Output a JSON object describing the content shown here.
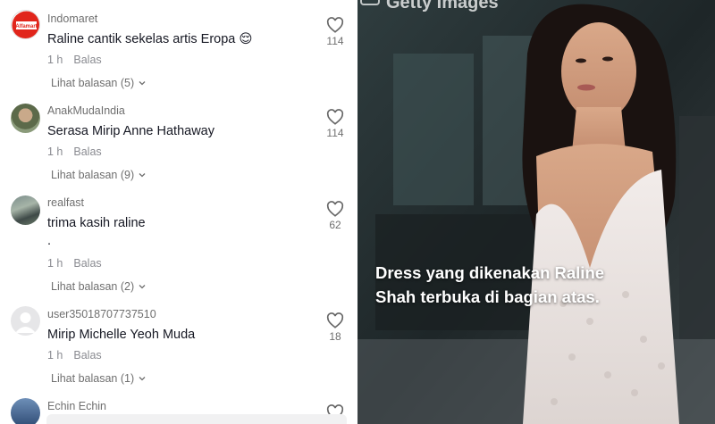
{
  "comments": [
    {
      "username": "Indomaret",
      "text": "Raline cantik sekelas artis Eropa 😌",
      "time": "1 h",
      "reply": "Balas",
      "replies": "Lihat balasan (5)",
      "likes": "114",
      "avatar": "indomaret-logo"
    },
    {
      "username": "AnakMudaIndia",
      "text": "Serasa Mirip Anne Hathaway",
      "time": "1 h",
      "reply": "Balas",
      "replies": "Lihat balasan (9)",
      "likes": "114",
      "avatar": "photo"
    },
    {
      "username": "realfast",
      "text": "trima kasih raline",
      "text2": ".",
      "time": "1 h",
      "reply": "Balas",
      "replies": "Lihat balasan (2)",
      "likes": "62",
      "avatar": "photo"
    },
    {
      "username": "user35018707737510",
      "text": "Mirip Michelle Yeoh Muda",
      "time": "1 h",
      "reply": "Balas",
      "replies": "Lihat balasan (1)",
      "likes": "18",
      "avatar": "default"
    },
    {
      "username": "Echin Echin",
      "avatar": "photo"
    }
  ],
  "indomaret_logo_text": "Alfamart",
  "image": {
    "watermark": "Getty Images",
    "caption_line1": "Dress yang dikenakan Raline",
    "caption_line2": "Shah terbuka di bagian atas."
  },
  "colors": {
    "text": "#161823",
    "muted": "#8a8b91",
    "indomaret_red": "#e1251b"
  },
  "icons": {
    "like": "heart-outline-icon",
    "expand": "chevron-down-icon"
  }
}
